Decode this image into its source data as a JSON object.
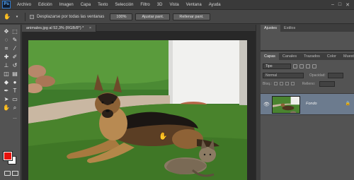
{
  "app": {
    "logo": "Ps"
  },
  "menu": [
    "Archivo",
    "Edición",
    "Imagen",
    "Capa",
    "Texto",
    "Selección",
    "Filtro",
    "3D",
    "Vista",
    "Ventana",
    "Ayuda"
  ],
  "window_controls": {
    "minimize": "–",
    "maximize": "□",
    "close": "✕"
  },
  "options": {
    "scroll_all_label": "Desplazarse por todas las ventanas",
    "zoom_100": "100%",
    "fit_screen": "Ajustar pant.",
    "fill_screen": "Rellenar pant."
  },
  "document": {
    "tab_title": "animales.jpg al 52,3% (RGB/8*) *",
    "close_glyph": "×"
  },
  "colors": {
    "foreground": "#e8120c",
    "background": "#ffffff",
    "selected_layer": "#6c7b8e"
  },
  "panels": {
    "top_tabs": [
      "Ajustes",
      "Estilos"
    ],
    "layer_tabs": [
      "Capas",
      "Canales",
      "Trazados",
      "Color",
      "Muestras"
    ],
    "kind": "Tipo",
    "blend_mode": "Normal",
    "opacity_label": "Opacidad:",
    "lock_label": "Bloq.:",
    "fill_label": "Relleno:"
  },
  "layers": [
    {
      "name": "Fondo",
      "visible": true,
      "locked": true
    }
  ],
  "icons": {
    "hand_tool": "hand-icon",
    "cursor": "hand-cursor-icon"
  }
}
